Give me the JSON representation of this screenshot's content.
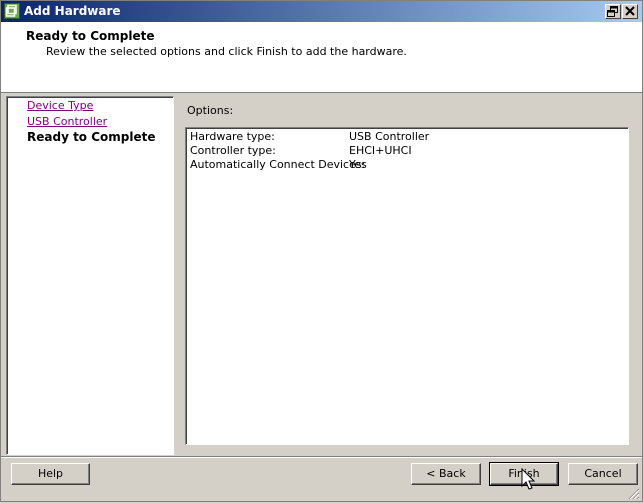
{
  "window": {
    "title": "Add Hardware",
    "title_bar_color": "#0a246a",
    "title_bar_color_end": "#a6caf0",
    "app_icon": "vmware-icon",
    "controls": [
      "restore-icon",
      "close-icon"
    ]
  },
  "header": {
    "title": "Ready to Complete",
    "subtitle": "Review the selected options and click Finish to add the hardware."
  },
  "nav": {
    "items": [
      {
        "label": "Device Type",
        "visited": true
      },
      {
        "label": "USB Controller",
        "visited": true
      },
      {
        "label": "Ready to Complete",
        "current": true
      }
    ],
    "link_color": "#800080"
  },
  "options": {
    "label": "Options:",
    "rows": [
      {
        "key": "Hardware type:",
        "value": "USB Controller"
      },
      {
        "key": "Controller type:",
        "value": "EHCI+UHCI"
      },
      {
        "key": "Automatically Connect Devices:",
        "value": "Yes"
      }
    ]
  },
  "buttons": {
    "help": "Help",
    "back": "< Back",
    "finish": "Finish",
    "cancel": "Cancel"
  },
  "icons": {
    "cursor": "arrow-cursor-icon",
    "grip": "resize-grip-icon"
  }
}
